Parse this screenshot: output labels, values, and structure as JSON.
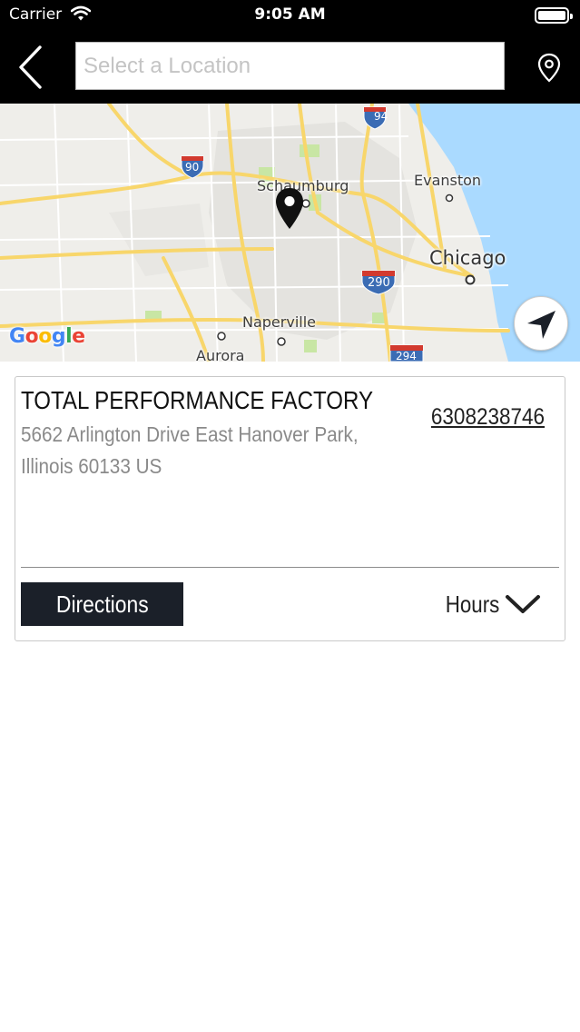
{
  "status_bar": {
    "carrier": "Carrier",
    "time": "9:05 AM"
  },
  "header": {
    "search_placeholder": "Select a Location",
    "search_value": ""
  },
  "map": {
    "provider": "Google",
    "labels": {
      "schaumburg": "Schaumburg",
      "evanston": "Evanston",
      "chicago": "Chicago",
      "naperville": "Naperville",
      "aurora": "Aurora"
    },
    "shields": {
      "i94": "94",
      "i90": "90",
      "i290": "290",
      "i294": "294"
    }
  },
  "location": {
    "name": "TOTAL PERFORMANCE FACTORY",
    "address_line1": "5662 Arlington Drive East Hanover Park,",
    "address_line2": "Illinois 60133 US",
    "phone": "6308238746",
    "directions_label": "Directions",
    "hours_label": "Hours"
  },
  "colors": {
    "bar_background": "#000000",
    "button_dark": "#1b2029",
    "water": "#aadaff",
    "road_yellow": "#f8d66b",
    "interstate_blue": "#3b6cb4",
    "interstate_red": "#d23a2f"
  }
}
